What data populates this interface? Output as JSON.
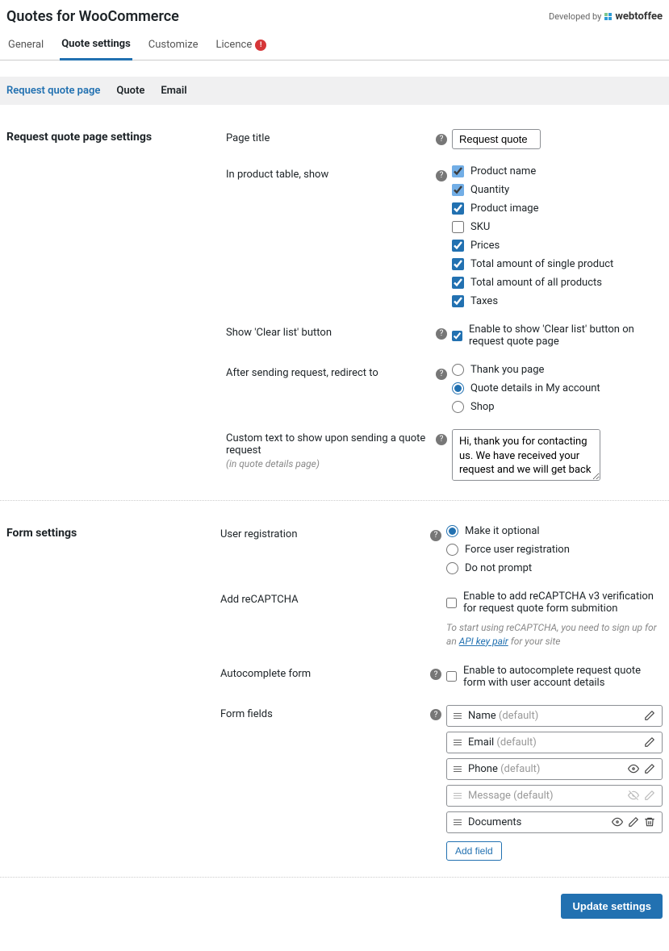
{
  "header": {
    "title": "Quotes for WooCommerce",
    "developed_by": "Developed by",
    "brand": "webtoffee"
  },
  "tabs": [
    {
      "label": "General",
      "active": false
    },
    {
      "label": "Quote settings",
      "active": true
    },
    {
      "label": "Customize",
      "active": false
    },
    {
      "label": "Licence",
      "active": false,
      "alert": true,
      "alert_text": "!"
    }
  ],
  "subtabs": [
    {
      "label": "Request quote page",
      "active": true
    },
    {
      "label": "Quote",
      "active": false
    },
    {
      "label": "Email",
      "active": false
    }
  ],
  "section1": {
    "title": "Request quote page settings",
    "page_title": {
      "label": "Page title",
      "value": "Request quote"
    },
    "product_table": {
      "label": "In product table, show",
      "items": [
        {
          "label": "Product name",
          "checked": true,
          "locked": true
        },
        {
          "label": "Quantity",
          "checked": true,
          "locked": true
        },
        {
          "label": "Product image",
          "checked": true
        },
        {
          "label": "SKU",
          "checked": false
        },
        {
          "label": "Prices",
          "checked": true
        },
        {
          "label": "Total amount of single product",
          "checked": true
        },
        {
          "label": "Total amount of all products",
          "checked": true
        },
        {
          "label": "Taxes",
          "checked": true
        }
      ]
    },
    "clear_list": {
      "label": "Show 'Clear list' button",
      "opt": "Enable to show 'Clear list' button on request quote page",
      "checked": true
    },
    "redirect": {
      "label": "After sending request, redirect to",
      "options": [
        {
          "label": "Thank you page",
          "checked": false
        },
        {
          "label": "Quote details in My account",
          "checked": true
        },
        {
          "label": "Shop",
          "checked": false
        }
      ]
    },
    "custom_text": {
      "label": "Custom text to show upon sending a quote request",
      "sub": "(in quote details page)",
      "value": "Hi, thank you for contacting us. We have received your request and we will get back to you soon."
    }
  },
  "section2": {
    "title": "Form settings",
    "user_reg": {
      "label": "User registration",
      "options": [
        {
          "label": "Make it optional",
          "checked": true
        },
        {
          "label": "Force user registration",
          "checked": false
        },
        {
          "label": "Do not prompt",
          "checked": false
        }
      ]
    },
    "recaptcha": {
      "label": "Add reCAPTCHA",
      "opt": "Enable to add reCAPTCHA v3 verification for request quote form submition",
      "checked": false,
      "hint_pre": "To start using reCAPTCHA, you need to sign up for an ",
      "hint_link": "API key pair",
      "hint_post": " for your site"
    },
    "autocomplete": {
      "label": "Autocomplete form",
      "opt": "Enable to autocomplete request quote form with user account details",
      "checked": false
    },
    "form_fields": {
      "label": "Form fields",
      "items": [
        {
          "name": "Name",
          "def": "(default)",
          "edit": true
        },
        {
          "name": "Email",
          "def": "(default)",
          "edit": true
        },
        {
          "name": "Phone",
          "def": "(default)",
          "eye": true,
          "edit": true
        },
        {
          "name": "Message",
          "def": "(default)",
          "muted": true,
          "eye": true,
          "eye_off": true,
          "edit": true
        },
        {
          "name": "Documents",
          "eye": true,
          "edit": true,
          "trash": true
        }
      ],
      "add_label": "Add field"
    }
  },
  "footer": {
    "update": "Update settings"
  }
}
